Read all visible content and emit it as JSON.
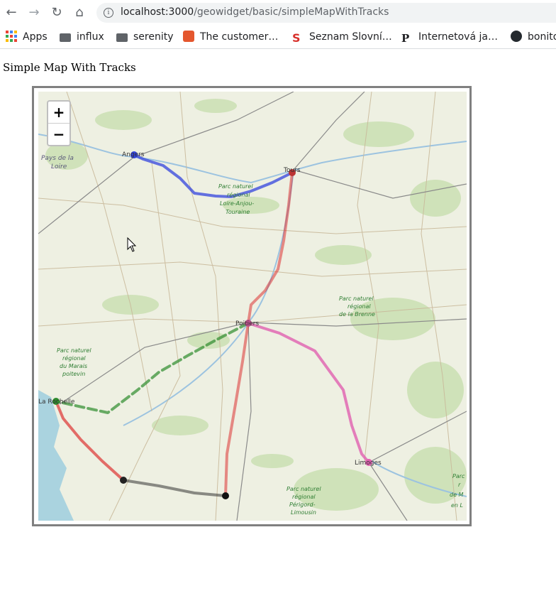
{
  "browser": {
    "url_host": "localhost:3000",
    "url_path": "/geowidget/basic/simpleMapWithTracks",
    "bookmarks": [
      {
        "label": "Apps"
      },
      {
        "label": "influx"
      },
      {
        "label": "serenity"
      },
      {
        "label": "The customer…"
      },
      {
        "label": "Seznam Slovní…"
      },
      {
        "label": "Internetová ja…"
      },
      {
        "label": "bonito"
      }
    ]
  },
  "page": {
    "title": "Simple Map With Tracks"
  },
  "map": {
    "zoom_in": "+",
    "zoom_out": "−",
    "places": {
      "angers": "Angers",
      "tours": "Tours",
      "poitiers": "Poitiers",
      "la_rochelle": "La Rochelle",
      "limoges": "Limoges"
    },
    "regions": {
      "pays_de_la_loire_1": "Pays de la",
      "pays_de_la_loire_2": "Loire"
    },
    "parks": {
      "loire_1": "Parc naturel",
      "loire_2": "régional",
      "loire_3": "Loire-Anjou-",
      "loire_4": "Touraine",
      "brenne_1": "Parc naturel",
      "brenne_2": "régional",
      "brenne_3": "de la Brenne",
      "marais_1": "Parc naturel",
      "marais_2": "régional",
      "marais_3": "du Marais",
      "marais_4": "poitevin",
      "perigord_1": "Parc naturel",
      "perigord_2": "régional",
      "perigord_3": "Périgord-",
      "perigord_4": "Limousin",
      "right_1": "Parc",
      "right_2": "r",
      "right_3": "de M",
      "right_4": "en L"
    },
    "tracks": [
      {
        "name": "blue",
        "color": "#3344dd"
      },
      {
        "name": "red",
        "color": "#dd3333"
      },
      {
        "name": "pink",
        "color": "#e060b0"
      },
      {
        "name": "green",
        "color": "#2e8b2e"
      },
      {
        "name": "black",
        "color": "#222222"
      }
    ]
  }
}
